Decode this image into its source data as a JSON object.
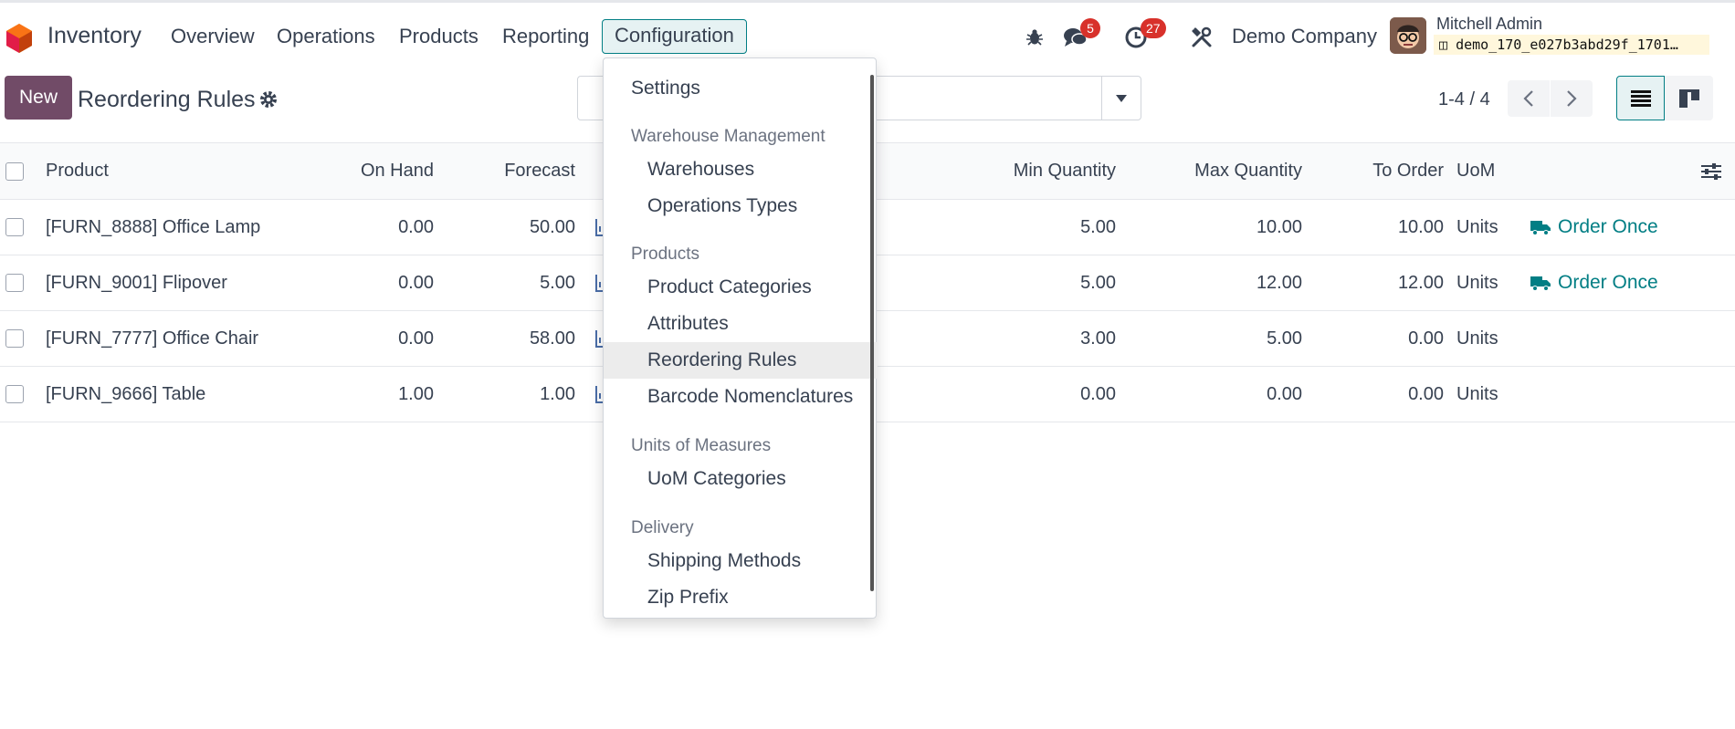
{
  "navbar": {
    "app_name": "Inventory",
    "menu": [
      "Overview",
      "Operations",
      "Products",
      "Reporting",
      "Configuration"
    ],
    "messages_badge": "5",
    "activities_badge": "27",
    "company": "Demo Company",
    "user_name": "Mitchell Admin",
    "db_name": "demo_170_e027b3abd29f_1701…"
  },
  "control": {
    "new_label": "New",
    "title": "Reordering Rules",
    "pager": "1-4 / 4"
  },
  "table": {
    "columns": [
      "Product",
      "On Hand",
      "Forecast",
      "Min Quantity",
      "Max Quantity",
      "To Order",
      "UoM"
    ],
    "rows": [
      {
        "product": "[FURN_8888] Office Lamp",
        "on_hand": "0.00",
        "forecast": "50.00",
        "min": "5.00",
        "max": "10.00",
        "to_order": "10.00",
        "uom": "Units",
        "action": "Order Once"
      },
      {
        "product": "[FURN_9001] Flipover",
        "on_hand": "0.00",
        "forecast": "5.00",
        "min": "5.00",
        "max": "12.00",
        "to_order": "12.00",
        "uom": "Units",
        "action": "Order Once"
      },
      {
        "product": "[FURN_7777] Office Chair",
        "on_hand": "0.00",
        "forecast": "58.00",
        "min": "3.00",
        "max": "5.00",
        "to_order": "0.00",
        "uom": "Units",
        "action": ""
      },
      {
        "product": "[FURN_9666] Table",
        "on_hand": "1.00",
        "forecast": "1.00",
        "min": "0.00",
        "max": "0.00",
        "to_order": "0.00",
        "uom": "Units",
        "action": ""
      }
    ]
  },
  "dropdown": {
    "settings": "Settings",
    "sections": [
      {
        "header": "Warehouse Management",
        "items": [
          "Warehouses",
          "Operations Types"
        ]
      },
      {
        "header": "Products",
        "items": [
          "Product Categories",
          "Attributes",
          "Reordering Rules",
          "Barcode Nomenclatures"
        ]
      },
      {
        "header": "Units of Measures",
        "items": [
          "UoM Categories"
        ]
      },
      {
        "header": "Delivery",
        "items": [
          "Shipping Methods",
          "Zip Prefix"
        ]
      }
    ],
    "selected": "Reordering Rules"
  },
  "colors": {
    "brand": "#714b67",
    "accent": "#017e84",
    "badge": "#d8312b"
  }
}
